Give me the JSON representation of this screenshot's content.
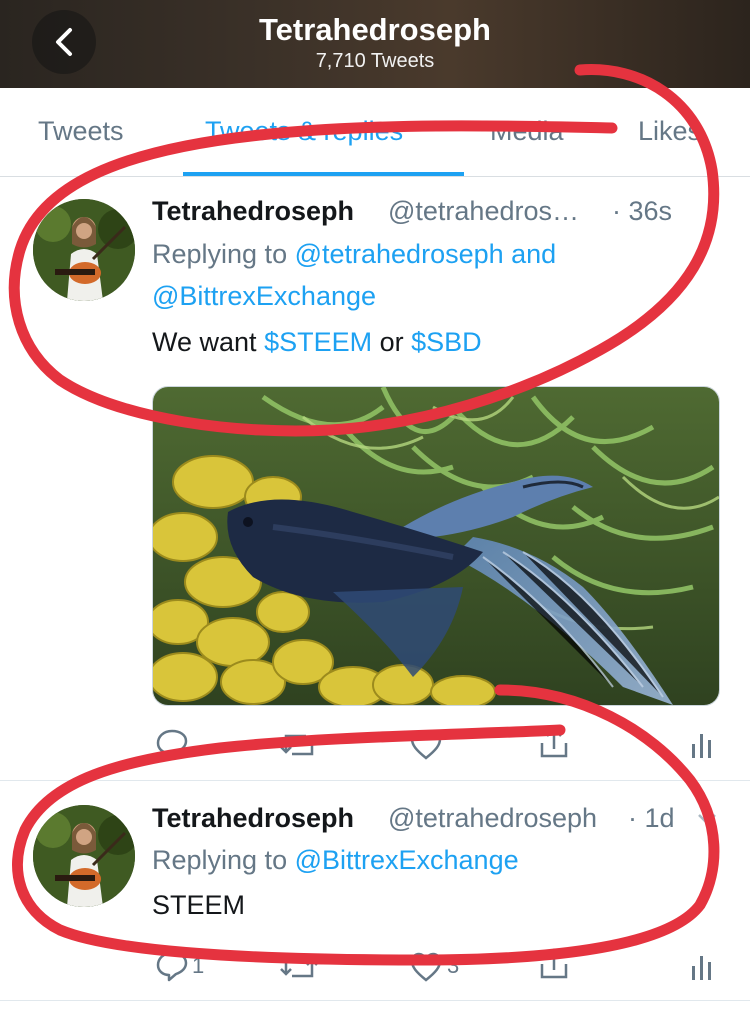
{
  "header": {
    "title": "Tetrahedroseph",
    "subtitle": "7,710 Tweets"
  },
  "tabs": [
    {
      "label": "Tweets",
      "active": false
    },
    {
      "label": "Tweets & replies",
      "active": true
    },
    {
      "label": "Media",
      "active": false
    },
    {
      "label": "Likes",
      "active": false
    }
  ],
  "tweets": [
    {
      "name": "Tetrahedroseph",
      "handle": "@tetrahedros…",
      "time": "· 36s",
      "replying_prefix": "Replying to ",
      "replying_to_1": "@tetrahedroseph",
      "replying_and": " and",
      "replying_to_2": "@BittrexExchange",
      "text_parts": {
        "a": "We want ",
        "tag1": "$STEEM",
        "b": " or ",
        "tag2": "$SBD"
      },
      "has_media": true,
      "actions": {
        "reply_count": "",
        "retweet_count": "",
        "like_count": ""
      }
    },
    {
      "name": "Tetrahedroseph",
      "handle": "@tetrahedroseph",
      "time": "· 1d",
      "replying_prefix": "Replying to ",
      "replying_to_1": "@BittrexExchange",
      "text": "STEEM",
      "actions": {
        "reply_count": "1",
        "retweet_count": "",
        "like_count": "3"
      }
    }
  ],
  "colors": {
    "accent": "#1da1f2",
    "annotation": "#e5333f"
  },
  "icons": [
    "back-chevron-icon",
    "reply-icon",
    "retweet-icon",
    "like-icon",
    "share-icon",
    "analytics-icon",
    "caret-down-icon"
  ]
}
